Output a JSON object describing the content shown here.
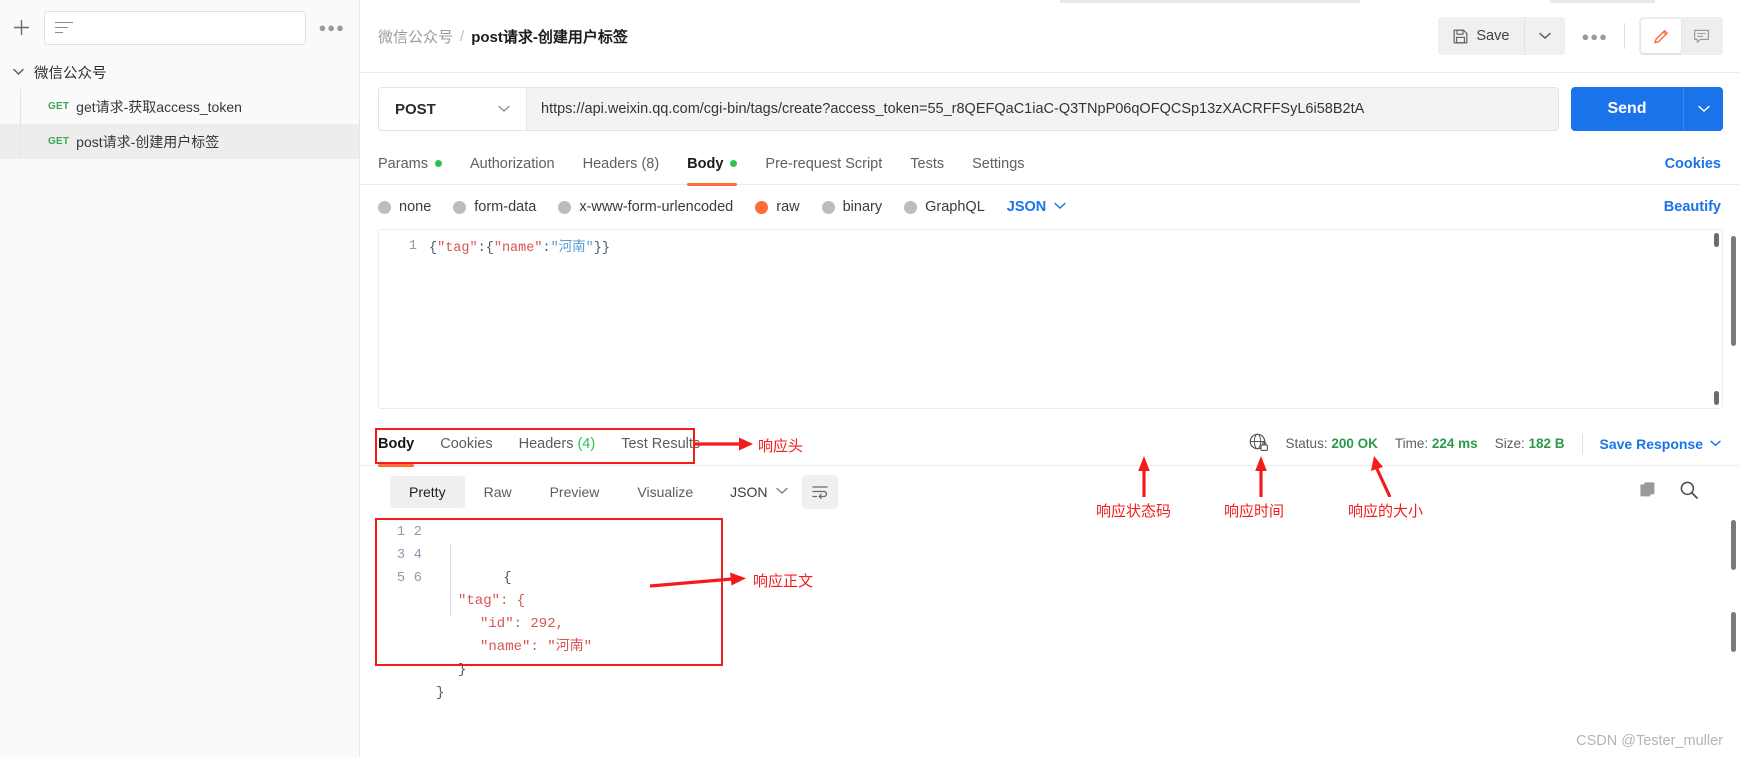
{
  "sidebar": {
    "new_button": "+",
    "filter_placeholder": "",
    "more_menu": "●●●",
    "collection": {
      "name": "微信公众号",
      "expanded": true
    },
    "requests": [
      {
        "method": "GET",
        "name": "get请求-获取access_token",
        "selected": false
      },
      {
        "method": "GET",
        "name": "post请求-创建用户标签",
        "selected": true
      }
    ]
  },
  "header": {
    "breadcrumb_collection": "微信公众号",
    "breadcrumb_separator": "/",
    "breadcrumb_current": "post请求-创建用户标签",
    "save_label": "Save",
    "save_caret": "⌄",
    "more_menu": "●●●",
    "edit_icon": "pencil-icon",
    "comment_icon": "comment-icon"
  },
  "url_bar": {
    "method": "POST",
    "method_caret": "⌄",
    "url": "https://api.weixin.qq.com/cgi-bin/tags/create?access_token=55_r8QEFQaC1iaC-Q3TNpP06qOFQCSp13zXACRFFSyL6i58B2tA",
    "send_label": "Send",
    "send_caret": "⌄"
  },
  "request_tabs": [
    {
      "label": "Params",
      "dot": true,
      "active": false
    },
    {
      "label": "Authorization",
      "dot": false,
      "active": false
    },
    {
      "label": "Headers (8)",
      "dot": false,
      "active": false
    },
    {
      "label": "Body",
      "dot": true,
      "active": true
    },
    {
      "label": "Pre-request Script",
      "dot": false,
      "active": false
    },
    {
      "label": "Tests",
      "dot": false,
      "active": false
    },
    {
      "label": "Settings",
      "dot": false,
      "active": false
    }
  ],
  "cookies_link": "Cookies",
  "body_types": [
    {
      "label": "none",
      "selected": false
    },
    {
      "label": "form-data",
      "selected": false
    },
    {
      "label": "x-www-form-urlencoded",
      "selected": false
    },
    {
      "label": "raw",
      "selected": true
    },
    {
      "label": "binary",
      "selected": false
    },
    {
      "label": "GraphQL",
      "selected": false
    }
  ],
  "body_format": {
    "label": "JSON",
    "caret": "⌄"
  },
  "beautify": "Beautify",
  "request_body": {
    "line_number": "1",
    "tokens": {
      "open1": "{",
      "key_tag": "\"tag\"",
      "colon1": ":",
      "open2": "{",
      "key_name": "\"name\"",
      "colon2": ":",
      "value_name": "\"河南\"",
      "close": "}}"
    }
  },
  "response_tabs": [
    {
      "label": "Body",
      "count": "",
      "active": true
    },
    {
      "label": "Cookies",
      "count": "",
      "active": false
    },
    {
      "label": "Headers",
      "count": "(4)",
      "active": false
    },
    {
      "label": "Test Results",
      "count": "",
      "active": false
    }
  ],
  "status_bar": {
    "shield_icon": "globe-lock-icon",
    "status_label": "Status:",
    "status_value": "200 OK",
    "time_label": "Time:",
    "time_value": "224 ms",
    "size_label": "Size:",
    "size_value": "182 B",
    "save_response": "Save Response",
    "save_response_caret": "⌄"
  },
  "response_sub_tabs": [
    {
      "label": "Pretty",
      "active": true
    },
    {
      "label": "Raw",
      "active": false
    },
    {
      "label": "Preview",
      "active": false
    },
    {
      "label": "Visualize",
      "active": false
    }
  ],
  "response_format": {
    "label": "JSON",
    "caret": "⌄"
  },
  "response_body": {
    "lines": [
      "1",
      "2",
      "3",
      "4",
      "5",
      "6"
    ],
    "rows": [
      {
        "indent": 0,
        "text": "{"
      },
      {
        "indent": 1,
        "text": "\"tag\": {"
      },
      {
        "indent": 2,
        "text": "\"id\": 292,"
      },
      {
        "indent": 2,
        "text": "\"name\": \"河南\""
      },
      {
        "indent": 1,
        "text": "}"
      },
      {
        "indent": 0,
        "text": "}"
      }
    ],
    "parsed": {
      "tag": {
        "id": 292,
        "name": "河南"
      }
    }
  },
  "annotations": {
    "color": "#f31c1c",
    "response_header": "响应头",
    "response_status_code": "响应状态码",
    "response_time": "响应时间",
    "response_size": "响应的大小",
    "response_body": "响应正文"
  },
  "watermark": "CSDN @Tester_muller"
}
